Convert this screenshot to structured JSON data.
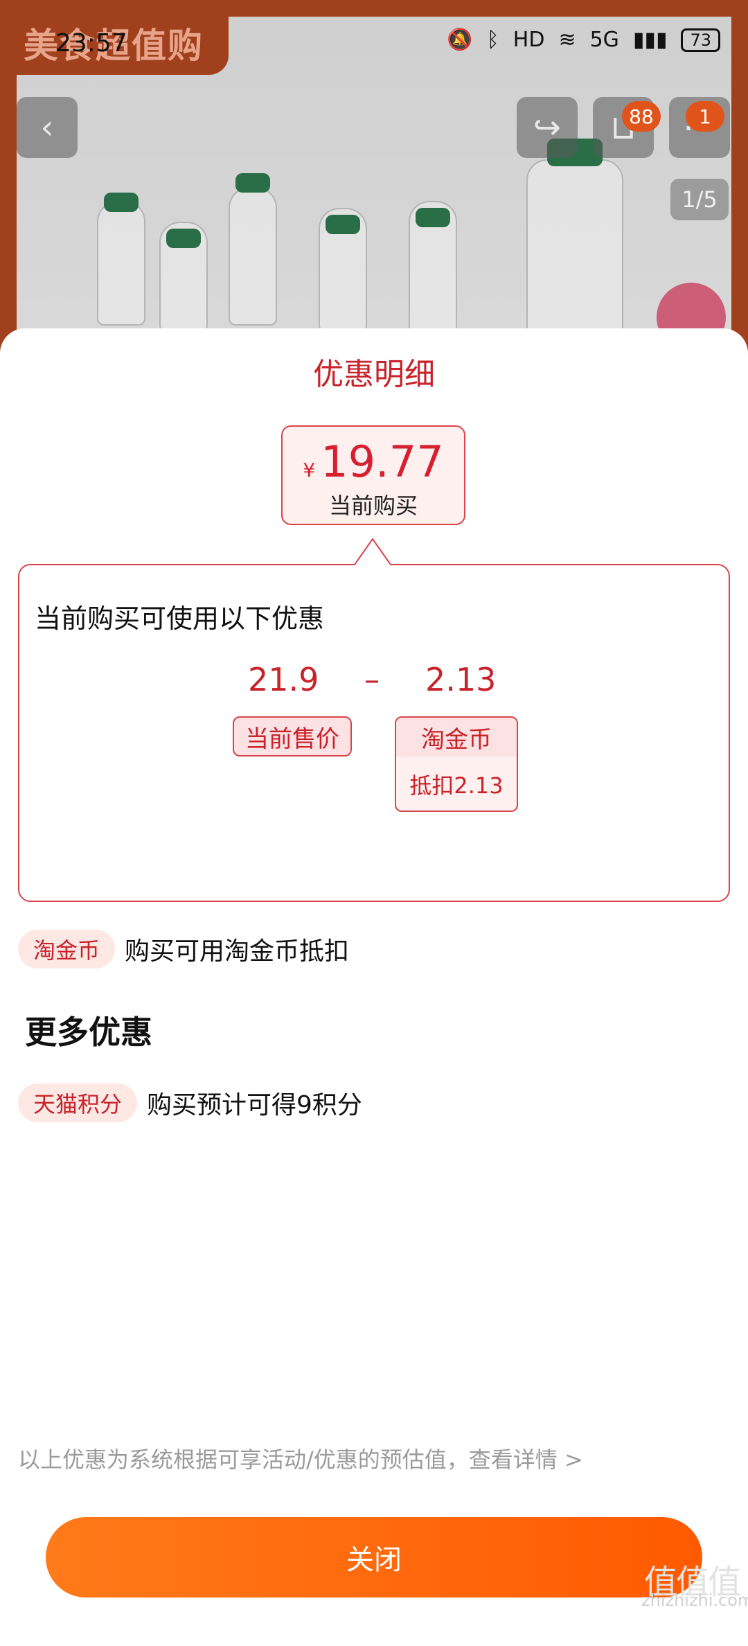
{
  "status_bar": {
    "time": "23:57",
    "network": "5G",
    "hd": "HD",
    "battery": "73"
  },
  "background": {
    "brand": "美食超值购",
    "cart_badge": "88",
    "more_badge": "1",
    "pager": "1/5"
  },
  "sheet": {
    "title": "优惠明细",
    "price": {
      "currency": "¥",
      "value": "19.77",
      "label": "当前购买"
    },
    "detail": {
      "heading": "当前购买可使用以下优惠",
      "amount_1": "21.9",
      "operator": "–",
      "amount_2": "2.13",
      "tag_sale": "当前售价",
      "tag_coin_title": "淘金币",
      "tag_coin_desc": "抵扣2.13"
    },
    "coin_row": {
      "pill": "淘金币",
      "text": "购买可用淘金币抵扣"
    },
    "more_title": "更多优惠",
    "points_row": {
      "pill": "天猫积分",
      "text": "购买预计可得9积分"
    },
    "footnote": "以上优惠为系统根据可享活动/优惠的预估值，查看详情 >",
    "close_label": "关闭"
  },
  "watermark": {
    "text": "zhizhizhi.com",
    "glyphs": "值值值"
  },
  "colors": {
    "accent_red": "#c8222a",
    "button_orange": "#ff6a10"
  }
}
